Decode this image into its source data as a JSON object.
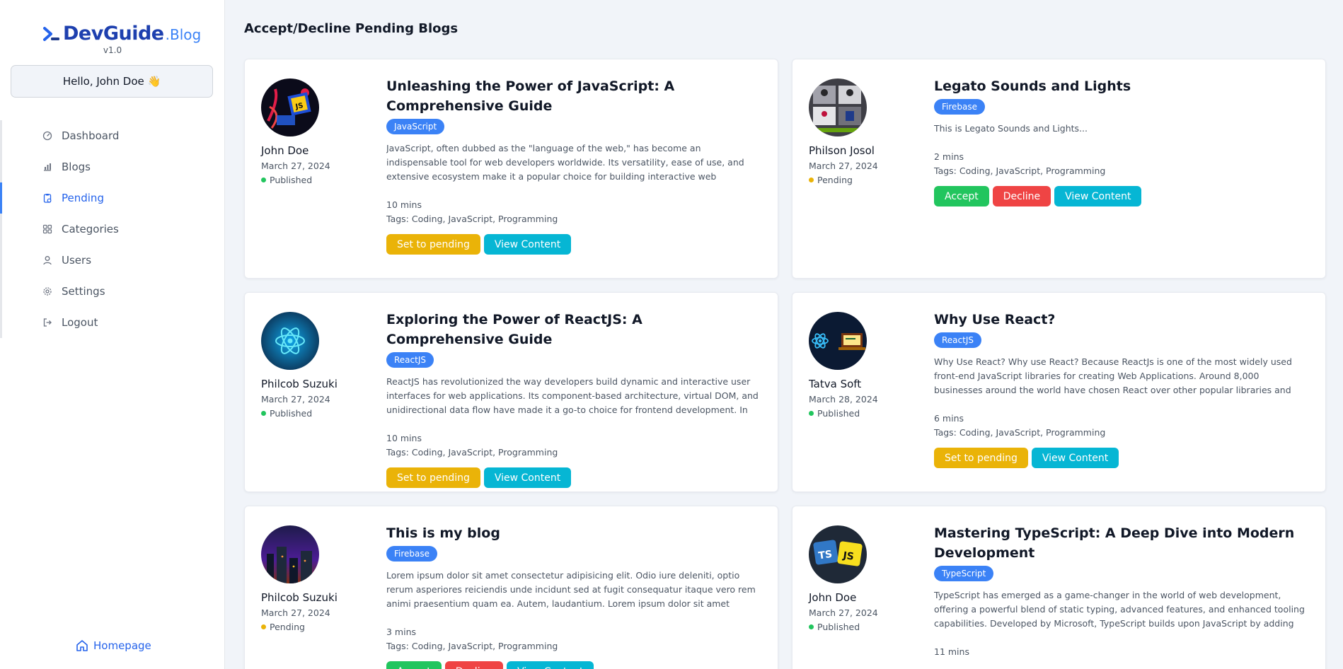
{
  "brand": {
    "name": "DevGuide",
    "suffix": ".Blog",
    "version": "v1.0",
    "accent": "#3b82f6"
  },
  "greeting": "Hello, John Doe 👋",
  "nav": {
    "items": [
      {
        "label": "Dashboard",
        "icon": "dashboard-icon"
      },
      {
        "label": "Blogs",
        "icon": "chart-icon"
      },
      {
        "label": "Pending",
        "icon": "clipboard-icon",
        "active": true
      },
      {
        "label": "Categories",
        "icon": "grid-icon"
      },
      {
        "label": "Users",
        "icon": "user-icon"
      },
      {
        "label": "Settings",
        "icon": "gear-icon"
      },
      {
        "label": "Logout",
        "icon": "logout-icon"
      }
    ],
    "homepage": "Homepage"
  },
  "page_title": "Accept/Decline Pending Blogs",
  "labels": {
    "set_to_pending": "Set to pending",
    "view_content": "View Content",
    "accept": "Accept",
    "decline": "Decline"
  },
  "status_colors": {
    "Published": "#22c55e",
    "Pending": "#eab308"
  },
  "cards": [
    {
      "author": "John Doe",
      "date": "March 27, 2024",
      "status": "Published",
      "title": "Unleashing the Power of JavaScript: A Comprehensive Guide",
      "tag": "JavaScript",
      "excerpt": "JavaScript, often dubbed as the \"language of the web,\" has become an indispensable tool for web developers worldwide. Its versatility, ease of use, and extensive ecosystem make it a popular choice for building interactive web applications, server-sid...",
      "read_time": "10 mins",
      "tags": "Tags: Coding, JavaScript, Programming",
      "avatar": "javascript-avatar"
    },
    {
      "author": "Philson Josol",
      "date": "March 27, 2024",
      "status": "Pending",
      "title": "Legato Sounds and Lights",
      "tag": "Firebase",
      "excerpt": "This is Legato Sounds and Lights...",
      "read_time": "2 mins",
      "tags": "Tags: Coding, JavaScript, Programming",
      "avatar": "video-call-avatar"
    },
    {
      "author": "Philcob Suzuki",
      "date": "March 27, 2024",
      "status": "Published",
      "title": "Exploring the Power of ReactJS: A Comprehensive Guide",
      "tag": "ReactJS",
      "excerpt": "ReactJS has revolutionized the way developers build dynamic and interactive user interfaces for web applications. Its component-based architecture, virtual DOM, and unidirectional data flow have made it a go-to choice for frontend development. In thi...",
      "read_time": "10 mins",
      "tags": "Tags: Coding, JavaScript, Programming",
      "avatar": "react-avatar"
    },
    {
      "author": "Tatva Soft",
      "date": "March 28, 2024",
      "status": "Published",
      "title": "Why Use React?",
      "tag": "ReactJS",
      "excerpt": "Why Use React? Why use React? Because ReactJs is one of the most widely used front-end JavaScript libraries for creating Web Applications. Around 8,000 businesses around the world have chosen React over other popular libraries and frameworks for bui...",
      "read_time": "6 mins",
      "tags": "Tags: Coding, JavaScript, Programming",
      "avatar": "react-laptop-avatar"
    },
    {
      "author": "Philcob Suzuki",
      "date": "March 27, 2024",
      "status": "Pending",
      "title": "This is my blog",
      "tag": "Firebase",
      "excerpt": "Lorem ipsum dolor sit amet consectetur adipisicing elit. Odio iure deleniti, optio rerum asperiores reiciendis unde incidunt sed at fugit consequatur itaque vero rem animi praesentium quam ea. Autem, laudantium. Lorem ipsum dolor sit amet consectetur...",
      "read_time": "3 mins",
      "tags": "Tags: Coding, JavaScript, Programming",
      "avatar": "night-city-avatar"
    },
    {
      "author": "John Doe",
      "date": "March 27, 2024",
      "status": "Published",
      "title": "Mastering TypeScript: A Deep Dive into Modern Development",
      "tag": "TypeScript",
      "excerpt": "TypeScript has emerged as a game-changer in the world of web development, offering a powerful blend of static typing, advanced features, and enhanced tooling capabilities. Developed by Microsoft, TypeScript builds upon JavaScript by adding static typ...",
      "read_time": "11 mins",
      "tags": "",
      "avatar": "typescript-avatar"
    }
  ]
}
